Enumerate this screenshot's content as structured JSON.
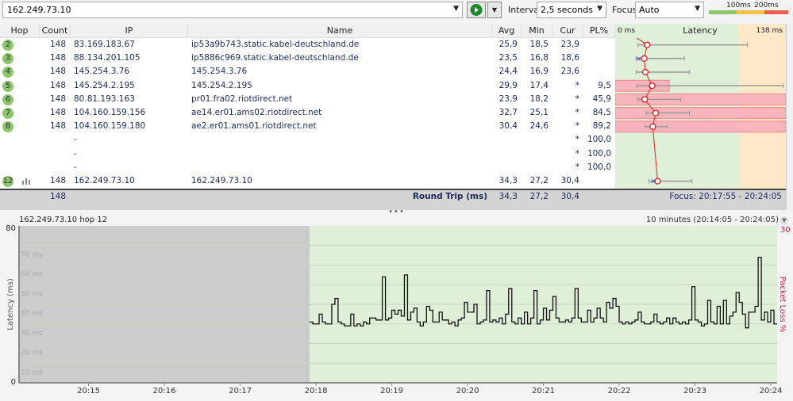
{
  "toolbar": {
    "target": "162.249.73.10",
    "interval_label": "Interval",
    "interval_value": "2,5 seconds",
    "focus_label": "Focus",
    "focus_value": "Auto",
    "scale_labels": [
      "100ms",
      "200ms"
    ],
    "scale_colors": [
      "#8cc56a",
      "#ffc04a",
      "#f06050"
    ]
  },
  "columns": {
    "hop": "Hop",
    "count": "Count",
    "ip": "IP",
    "name": "Name",
    "avg": "Avg",
    "min": "Min",
    "cur": "Cur",
    "pl": "PL%",
    "latency": "Latency",
    "lat_min": "0 ms",
    "lat_max": "138 ms"
  },
  "hops": [
    {
      "hop": "2",
      "count": "148",
      "ip": "83.169.183.67",
      "name": "ip53a9b743.static.kabel-deutschland.de",
      "avg": "25,9",
      "min": "18,5",
      "cur": "23,9",
      "pl": "",
      "g": {
        "avg": 25.9,
        "min": 18.5,
        "max": 107,
        "cur": 23.9,
        "pl": 0
      }
    },
    {
      "hop": "3",
      "count": "148",
      "ip": "88.134.201.105",
      "name": "ip5886c969.static.kabel-deutschland.de",
      "avg": "23,5",
      "min": "16,8",
      "cur": "18,6",
      "pl": "",
      "g": {
        "avg": 23.5,
        "min": 16.8,
        "max": 56,
        "cur": 18.6,
        "pl": 0
      }
    },
    {
      "hop": "4",
      "count": "148",
      "ip": "145.254.3.76",
      "name": "145.254.3.76",
      "avg": "24,4",
      "min": "16,9",
      "cur": "23,6",
      "pl": "",
      "g": {
        "avg": 24.4,
        "min": 16.9,
        "max": 60,
        "cur": 23.6,
        "pl": 0
      }
    },
    {
      "hop": "5",
      "count": "148",
      "ip": "145.254.2.195",
      "name": "145.254.2.195",
      "avg": "29,9",
      "min": "17,4",
      "cur": "*",
      "pl": "9,5",
      "g": {
        "avg": 29.9,
        "min": 17.4,
        "max": 136,
        "pl": 9.5
      }
    },
    {
      "hop": "6",
      "count": "148",
      "ip": "80.81.193.163",
      "name": "pr01.fra02.riotdirect.net",
      "avg": "23,9",
      "min": "18,2",
      "cur": "*",
      "pl": "45,9",
      "g": {
        "avg": 23.9,
        "min": 18.2,
        "max": 53,
        "pl": 45.9
      }
    },
    {
      "hop": "7",
      "count": "148",
      "ip": "104.160.159.156",
      "name": "ae14.er01.ams02.riotdirect.net",
      "avg": "32,7",
      "min": "25,1",
      "cur": "*",
      "pl": "84,5",
      "g": {
        "avg": 32.7,
        "min": 25.1,
        "max": 60,
        "pl": 84.5
      }
    },
    {
      "hop": "8",
      "count": "148",
      "ip": "104.160.159.180",
      "name": "ae2.er01.ams01.riotdirect.net",
      "avg": "30,4",
      "min": "24,6",
      "cur": "*",
      "pl": "89,2",
      "g": {
        "avg": 30.4,
        "min": 24.6,
        "max": 42,
        "pl": 89.2
      }
    },
    {
      "hop": "",
      "count": "-",
      "ip": "",
      "name": "",
      "avg": "",
      "min": "",
      "cur": "*",
      "pl": "100,0"
    },
    {
      "hop": "",
      "count": "-",
      "ip": "",
      "name": "",
      "avg": "",
      "min": "",
      "cur": "*",
      "pl": "100,0"
    },
    {
      "hop": "",
      "count": "-",
      "ip": "",
      "name": "",
      "avg": "",
      "min": "",
      "cur": "*",
      "pl": "100,0"
    },
    {
      "hop": "12",
      "count": "148",
      "ip": "162.249.73.10",
      "name": "162.249.73.10",
      "avg": "34,3",
      "min": "27,2",
      "cur": "30,4",
      "pl": "",
      "g": {
        "avg": 34.3,
        "min": 27.2,
        "max": 62,
        "cur": 30.4,
        "pl": 0
      }
    }
  ],
  "summary": {
    "count": "148",
    "label": "Round Trip (ms)",
    "avg": "34,3",
    "min": "27,2",
    "cur": "30,4",
    "focus": "Focus: 20:17:55 - 20:24:05"
  },
  "chart_data": {
    "type": "line",
    "title": "162.249.73.10 hop 12",
    "range_label": "10 minutes (20:14:05 - 20:24:05)",
    "ylabel": "Latency (ms)",
    "y2label": "Packet Loss %",
    "ylim": [
      0,
      80
    ],
    "y2lim": [
      0,
      30
    ],
    "y_ticks": [
      "80",
      "0"
    ],
    "y2_ticks": [
      "30"
    ],
    "grid_labels": [
      "70 ms",
      "60 ms",
      "50 ms",
      "40 ms",
      "30 ms",
      "20 ms",
      "10 ms"
    ],
    "x_ticks": [
      "20:15",
      "20:16",
      "20:17",
      "20:18",
      "20:19",
      "20:20",
      "20:21",
      "20:22",
      "20:23",
      "20:24"
    ],
    "x_range": [
      "20:14:05",
      "20:24:05"
    ],
    "focus_start": "20:17:55",
    "interval_s": 2.5,
    "colors": {
      "no_data": "#cccccc",
      "good": "#e0f0d8",
      "line": "#111111"
    },
    "values": [
      31,
      30,
      30,
      35,
      31,
      30,
      30,
      40,
      43,
      31,
      30,
      29,
      29,
      35,
      29,
      30,
      29,
      31,
      30,
      33,
      33,
      32,
      32,
      54,
      32,
      33,
      37,
      35,
      37,
      34,
      55,
      32,
      36,
      38,
      31,
      29,
      31,
      39,
      37,
      31,
      31,
      36,
      32,
      32,
      30,
      31,
      29,
      32,
      33,
      41,
      36,
      36,
      40,
      30,
      31,
      32,
      47,
      31,
      32,
      31,
      33,
      30,
      35,
      48,
      31,
      30,
      33,
      30,
      36,
      30,
      33,
      47,
      30,
      32,
      38,
      32,
      37,
      44,
      33,
      31,
      31,
      32,
      31,
      33,
      48,
      33,
      31,
      31,
      37,
      31,
      33,
      38,
      33,
      31,
      41,
      38,
      43,
      39,
      31,
      30,
      31,
      30,
      31,
      32,
      36,
      31,
      30,
      30,
      31,
      35,
      31,
      30,
      31,
      33,
      30,
      33,
      31,
      30,
      31,
      30,
      32,
      49,
      32,
      31,
      29,
      30,
      42,
      31,
      30,
      39,
      30,
      42,
      30,
      34,
      36,
      46,
      41,
      35,
      28,
      36,
      36,
      39,
      64,
      32,
      36,
      31,
      37,
      30
    ]
  }
}
